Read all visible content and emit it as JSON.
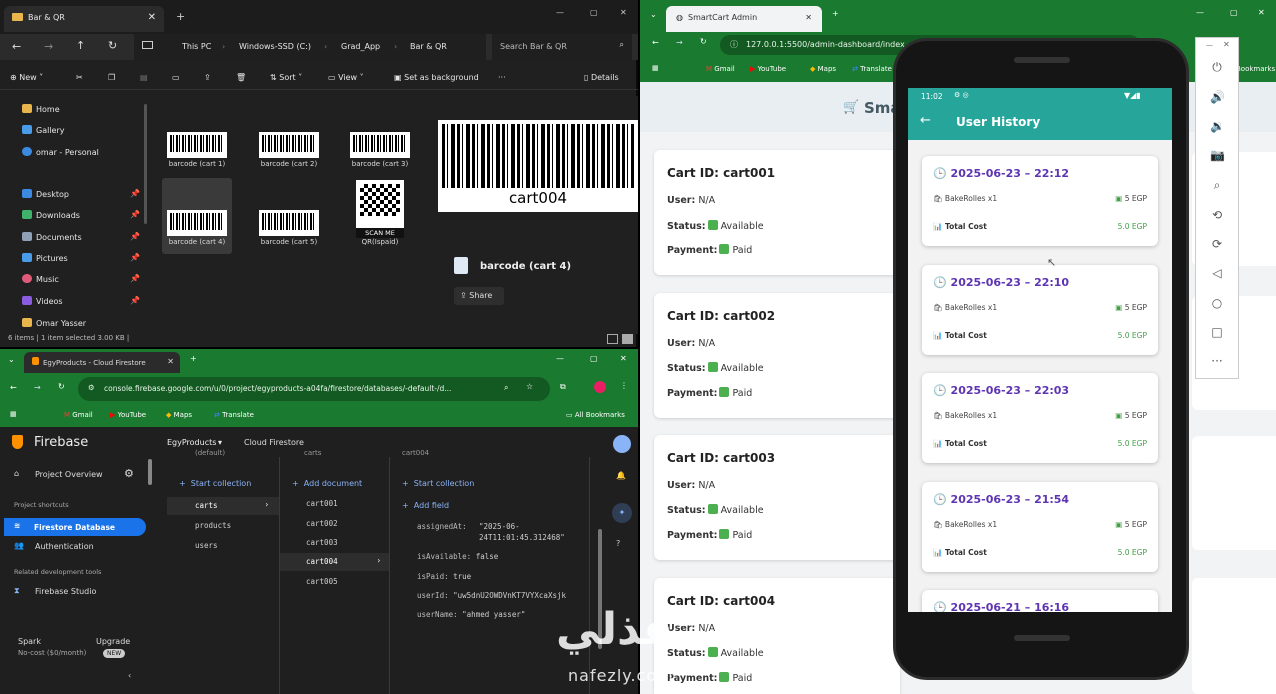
{
  "explorer": {
    "tab_title": "Bar & QR",
    "breadcrumbs": [
      "This PC",
      "Windows-SSD (C:)",
      "Grad_App",
      "Bar & QR"
    ],
    "search_placeholder": "Search Bar & QR",
    "toolbar": {
      "new": "New",
      "sort": "Sort",
      "view": "View",
      "set_bg": "Set as background",
      "details": "Details"
    },
    "nav": [
      "Home",
      "Gallery",
      "omar - Personal",
      "Desktop",
      "Downloads",
      "Documents",
      "Pictures",
      "Music",
      "Videos",
      "Omar Yasser"
    ],
    "files": [
      "barcode (cart 1)",
      "barcode (cart 2)",
      "barcode (cart 3)",
      "barcode (cart 4)",
      "barcode (cart 5)",
      "QR(Ispaid)"
    ],
    "qr_caption": "SCAN ME",
    "preview_text": "cart004",
    "preview_name": "barcode (cart 4)",
    "share": "Share",
    "status": "6 items  |  1 item selected  3.00 KB  |"
  },
  "firestore": {
    "tab_title": "EgyProducts - Cloud Firestore",
    "url": "console.firebase.google.com/u/0/project/egyproducts-a04fa/firestore/databases/-default-/d...",
    "bookmarks": [
      "Gmail",
      "YouTube",
      "Maps",
      "Translate"
    ],
    "all_bookmarks": "All Bookmarks",
    "brand": "Firebase",
    "project": "EgyProducts",
    "product": "Cloud Firestore",
    "project_overview": "Project Overview",
    "shortcuts": "Project shortcuts",
    "firestore_db": "Firestore Database",
    "authentication": "Authentication",
    "related": "Related development tools",
    "studio": "Firebase Studio",
    "plan": "Spark",
    "plan_sub": "No-cost ($0/month)",
    "upgrade": "Upgrade",
    "upgrade_badge": "NEW",
    "col1_header": "(default)",
    "col2_header": "carts",
    "col3_header": "cart004",
    "start_collection": "Start collection",
    "add_document": "Add document",
    "add_field": "Add field",
    "collections": [
      "carts",
      "products",
      "users"
    ],
    "documents": [
      "cart001",
      "cart002",
      "cart003",
      "cart004",
      "cart005"
    ],
    "fields": [
      {
        "k": "assignedAt:",
        "v": "\"2025-06-"
      },
      {
        "k": "",
        "v": "24T11:01:45.312468\""
      },
      {
        "k": "isAvailable:",
        "v": "false"
      },
      {
        "k": "isPaid:",
        "v": "true"
      },
      {
        "k": "userId:",
        "v": "\"uw5dnU2OWDVnKT7VYXcaXsjk"
      },
      {
        "k": "userName:",
        "v": "\"ahmed yasser\""
      }
    ]
  },
  "admin": {
    "tab_title": "SmartCart Admin",
    "url": "127.0.0.1:5500/admin-dashboard/index",
    "bookmarks": [
      "Gmail",
      "YouTube",
      "Maps",
      "Translate"
    ],
    "bookmarks_tail": "Bookmarks",
    "header": "Smart",
    "labels": {
      "user": "User:",
      "status": "Status:",
      "payment": "Payment:"
    },
    "carts": [
      {
        "id": "Cart ID: cart001",
        "user": "N/A",
        "status": "Available",
        "payment": "Paid"
      },
      {
        "id": "Cart ID: cart002",
        "user": "N/A",
        "status": "Available",
        "payment": "Paid"
      },
      {
        "id": "Cart ID: cart003",
        "user": "N/A",
        "status": "Available",
        "payment": "Paid"
      },
      {
        "id": "Cart ID: cart004",
        "user": "N/A",
        "status": "Available",
        "payment": "Paid"
      }
    ]
  },
  "phone": {
    "time": "11:02",
    "title": "User History",
    "total_label": "Total Cost",
    "history": [
      {
        "date": "2025-06-23 – 22:12",
        "item": "BakeRolles x1",
        "price": "5 EGP",
        "cost": "5.0 EGP"
      },
      {
        "date": "2025-06-23 – 22:10",
        "item": "BakeRolles x1",
        "price": "5 EGP",
        "cost": "5.0 EGP"
      },
      {
        "date": "2025-06-23 – 22:03",
        "item": "BakeRolles x1",
        "price": "5 EGP",
        "cost": "5.0 EGP"
      },
      {
        "date": "2025-06-23 – 21:54",
        "item": "BakeRolles x1",
        "price": "5 EGP",
        "cost": "5.0 EGP"
      },
      {
        "date": "2025-06-21 – 16:16"
      }
    ]
  },
  "watermark": {
    "arabic": "نفذلي",
    "latin": "nafezly.com"
  },
  "colors": {
    "teal": "#26a69a",
    "purple": "#5e35b1",
    "green": "#43a047",
    "firebase_blue": "#1a73e8"
  }
}
